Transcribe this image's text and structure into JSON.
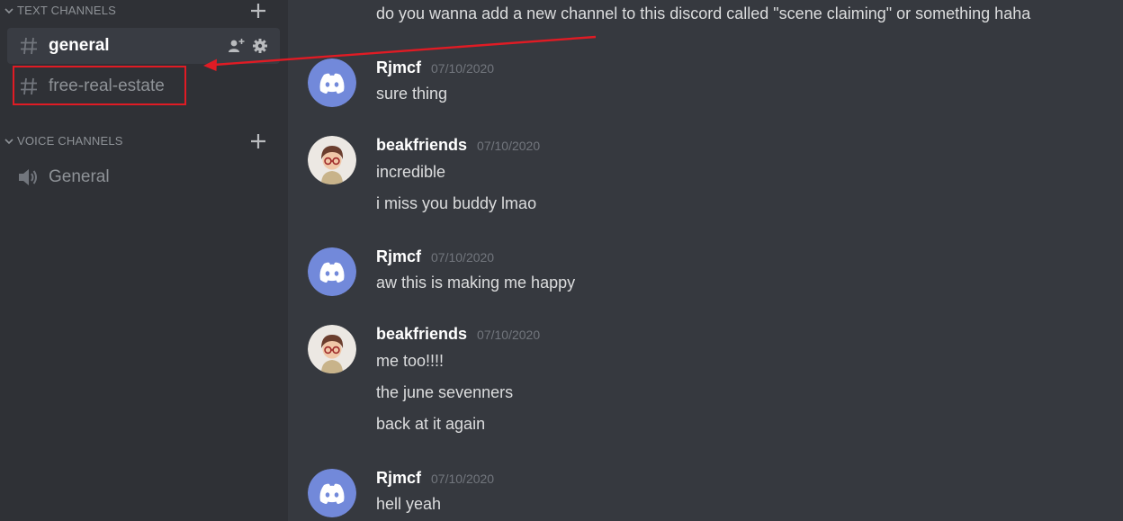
{
  "sidebar": {
    "text_category": "TEXT CHANNELS",
    "voice_category": "VOICE CHANNELS",
    "text_channels": [
      {
        "name": "general",
        "active": true
      },
      {
        "name": "free-real-estate",
        "active": false
      }
    ],
    "voice_channels": [
      {
        "name": "General"
      }
    ]
  },
  "messages": {
    "top_message": "do you wanna add a new channel to this discord called \"scene claiming\" or something haha",
    "groups": [
      {
        "author": "Rjmcf",
        "timestamp": "07/10/2020",
        "avatar": "discord-default-avatar",
        "lines": [
          "sure thing"
        ]
      },
      {
        "author": "beakfriends",
        "timestamp": "07/10/2020",
        "avatar": "character-avatar",
        "lines": [
          "incredible",
          "i miss you buddy lmao"
        ]
      },
      {
        "author": "Rjmcf",
        "timestamp": "07/10/2020",
        "avatar": "discord-default-avatar",
        "lines": [
          "aw this is making me happy"
        ]
      },
      {
        "author": "beakfriends",
        "timestamp": "07/10/2020",
        "avatar": "character-avatar",
        "lines": [
          "me too!!!!",
          "the june sevenners",
          "back at it again"
        ]
      },
      {
        "author": "Rjmcf",
        "timestamp": "07/10/2020",
        "avatar": "discord-default-avatar",
        "lines": [
          "hell yeah"
        ]
      }
    ]
  },
  "colors": {
    "sidebar_bg": "#2f3136",
    "chat_bg": "#36393f",
    "blurple": "#7289da",
    "annotation_red": "#e01b24"
  }
}
